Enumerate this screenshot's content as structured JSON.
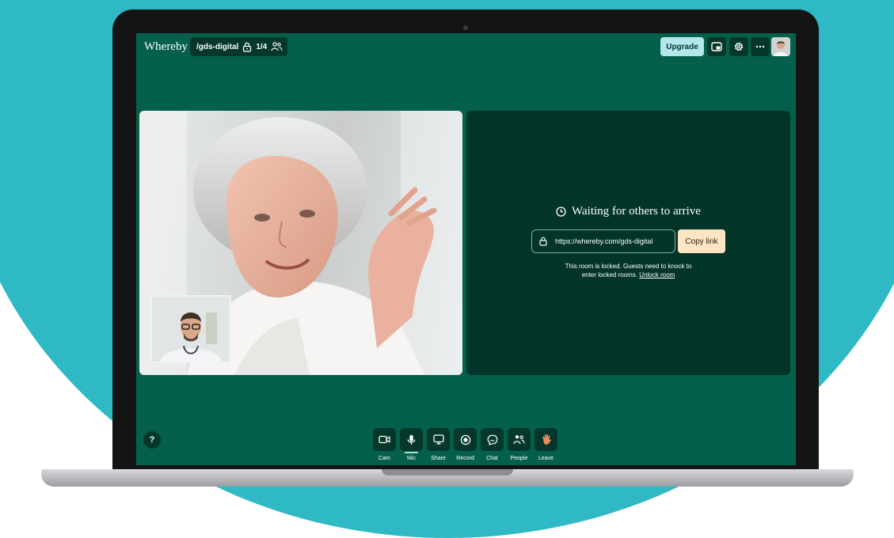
{
  "app": {
    "brand": "Whereby"
  },
  "room": {
    "name": "/gds-digital",
    "participant_count": "1/4",
    "lock_icon": "lock-icon",
    "people_icon": "people-icon"
  },
  "header": {
    "upgrade_label": "Upgrade",
    "icons": [
      "picture-in-picture-icon",
      "gear-icon",
      "more-icon"
    ]
  },
  "waiting": {
    "title": "Waiting for others to arrive",
    "room_link": "https://whereby.com/gds-digital",
    "copy_label": "Copy link",
    "note_line1": "This room is locked. Guests need to knock to",
    "note_line2": "enter locked rooms.",
    "unlock_label": "Unlock room"
  },
  "help_label": "?",
  "controls": [
    {
      "label": "Cam",
      "icon": "camera-icon"
    },
    {
      "label": "Mic",
      "icon": "microphone-icon",
      "active": true
    },
    {
      "label": "Share",
      "icon": "screen-share-icon"
    },
    {
      "label": "Record",
      "icon": "record-icon"
    },
    {
      "label": "Chat",
      "icon": "chat-icon"
    },
    {
      "label": "People",
      "icon": "people-icon"
    },
    {
      "label": "Leave",
      "icon": "wave-hand-icon"
    }
  ],
  "colors": {
    "backdrop": "#2fb9c4",
    "room_background": "#05604b",
    "panel": "#02342a",
    "upgrade": "#b5e6ec",
    "copy_button": "#fde5c4",
    "leave_icon": "#f08a5d"
  }
}
